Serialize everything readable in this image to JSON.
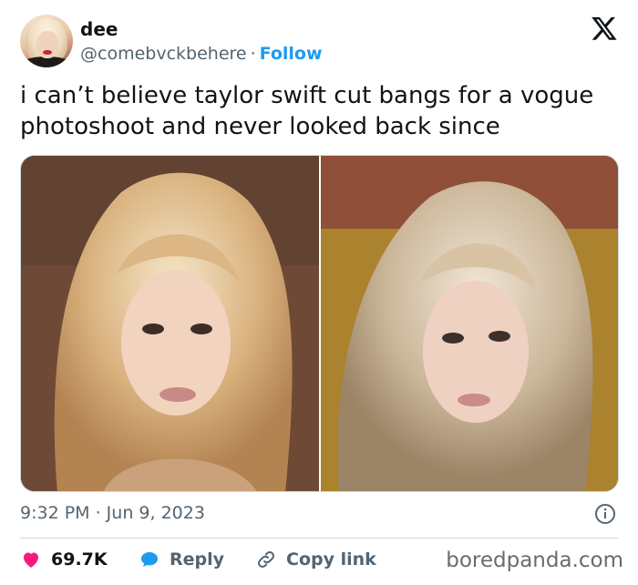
{
  "user": {
    "name": "dee",
    "handle": "@comebvckbehere",
    "separator": "·",
    "follow_label": "Follow"
  },
  "tweet": {
    "text_line1": "i can’t believe taylor swift cut bangs for a vogue",
    "text_line2": "photoshoot and never looked back since"
  },
  "media": {
    "photos": [
      "left-photo",
      "right-photo"
    ]
  },
  "meta": {
    "timestamp": "9:32 PM · Jun 9, 2023"
  },
  "actions": {
    "likes": "69.7K",
    "reply_label": "Reply",
    "copy_label": "Copy link"
  },
  "watermark": "boredpanda.com",
  "colors": {
    "accent": "#1d9bf0",
    "like": "#f91880",
    "muted": "#536471"
  }
}
